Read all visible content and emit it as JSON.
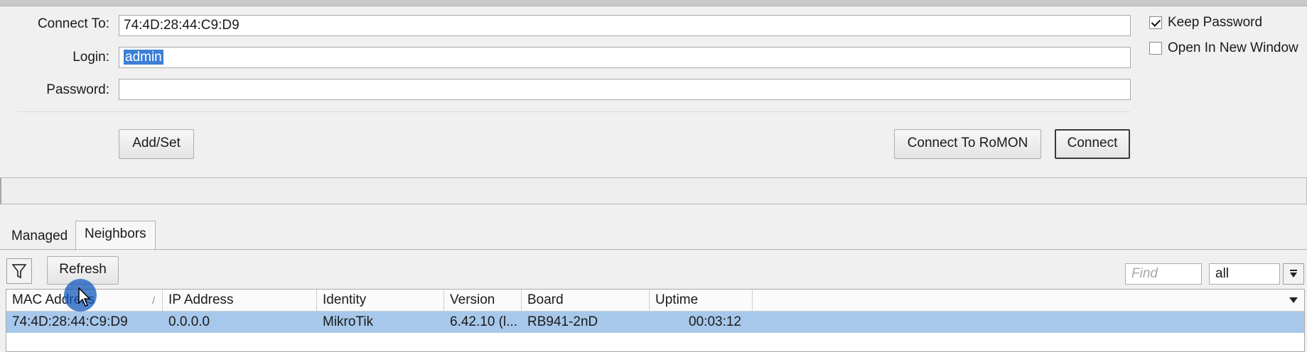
{
  "form": {
    "connect_to_label": "Connect To:",
    "connect_to_value": "74:4D:28:44:C9:D9",
    "login_label": "Login:",
    "login_value": "admin",
    "password_label": "Password:",
    "password_value": ""
  },
  "options": {
    "keep_password_label": "Keep Password",
    "keep_password_checked": true,
    "open_new_window_label": "Open In New Window",
    "open_new_window_checked": false
  },
  "buttons": {
    "add_set": "Add/Set",
    "connect_romon": "Connect To RoMON",
    "connect": "Connect"
  },
  "tabs": [
    {
      "label": "Managed",
      "active": false
    },
    {
      "label": "Neighbors",
      "active": true
    }
  ],
  "toolbar": {
    "refresh": "Refresh",
    "find_placeholder": "Find",
    "filter_value": "all"
  },
  "table": {
    "columns": [
      "MAC Address",
      "IP Address",
      "Identity",
      "Version",
      "Board",
      "Uptime"
    ],
    "rows": [
      {
        "mac": "74:4D:28:44:C9:D9",
        "ip": "0.0.0.0",
        "identity": "MikroTik",
        "version": "6.42.10 (l...",
        "board": "RB941-2nD",
        "uptime": "00:03:12",
        "selected": true
      }
    ]
  }
}
